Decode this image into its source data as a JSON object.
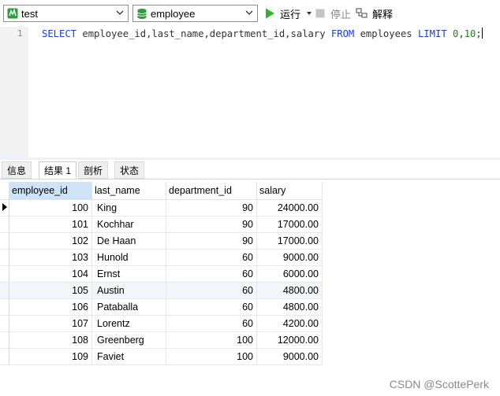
{
  "toolbar": {
    "connection": "test",
    "database": "employee",
    "run_label": "运行",
    "stop_label": "停止",
    "explain_label": "解释"
  },
  "editor": {
    "line_number": "1",
    "sql": {
      "select": "SELECT",
      "columns": " employee_id,last_name,department_id,salary ",
      "from": "FROM",
      "table": " employees ",
      "limit": "LIMIT",
      "offset": " 0",
      "comma": ",",
      "count": "10",
      "semicolon": ";"
    }
  },
  "tabs": [
    "信息",
    "结果 1",
    "剖析",
    "状态"
  ],
  "active_tab": "结果 1",
  "result": {
    "columns": [
      "employee_id",
      "last_name",
      "department_id",
      "salary"
    ],
    "rows": [
      [
        "100",
        "King",
        "90",
        "24000.00"
      ],
      [
        "101",
        "Kochhar",
        "90",
        "17000.00"
      ],
      [
        "102",
        "De Haan",
        "90",
        "17000.00"
      ],
      [
        "103",
        "Hunold",
        "60",
        "9000.00"
      ],
      [
        "104",
        "Ernst",
        "60",
        "6000.00"
      ],
      [
        "105",
        "Austin",
        "60",
        "4800.00"
      ],
      [
        "106",
        "Pataballa",
        "60",
        "4800.00"
      ],
      [
        "107",
        "Lorentz",
        "60",
        "4200.00"
      ],
      [
        "108",
        "Greenberg",
        "100",
        "12000.00"
      ],
      [
        "109",
        "Faviet",
        "100",
        "9000.00"
      ]
    ]
  },
  "watermark": "CSDN @ScottePerk",
  "colors": {
    "keyword": "#1e3ec5",
    "number": "#1f7f1f",
    "run_green": "#2db52d",
    "db_green": "#2e9e3a",
    "header_selected": "#cfe3f7"
  }
}
